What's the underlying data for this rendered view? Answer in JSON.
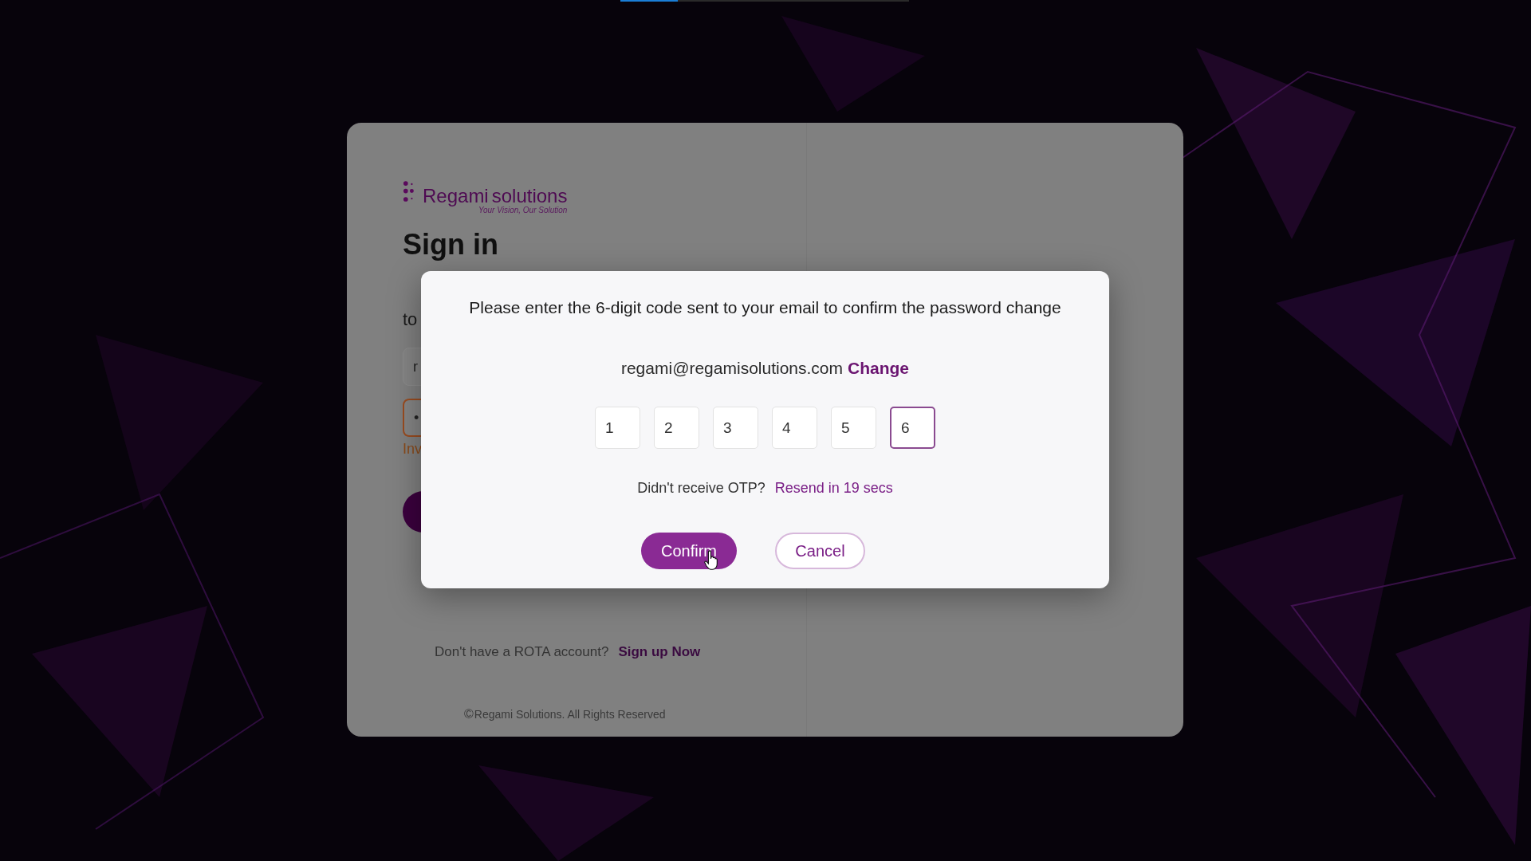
{
  "progress": {
    "level": 0.2
  },
  "brand": {
    "name_1": "Regami",
    "name_2": "solutions",
    "tagline": "Your Vision, Our Solution"
  },
  "signin": {
    "title": "Sign in",
    "subtitle": "to",
    "email_value": "r",
    "password_value": "•",
    "invalid": true,
    "error": "Inv"
  },
  "signup": {
    "prompt": "Don't have a ROTA account?",
    "link": "Sign up Now"
  },
  "copyright": {
    "symbol": "©",
    "text": "Regami Solutions. All Rights Reserved"
  },
  "dialog": {
    "message": "Please enter the 6-digit code sent to your email to confirm the password change",
    "email": "regami@regamisolutions.com",
    "change": "Change",
    "otp": [
      {
        "digit": "1",
        "focused": false
      },
      {
        "digit": "2",
        "focused": false
      },
      {
        "digit": "3",
        "focused": false
      },
      {
        "digit": "4",
        "focused": false
      },
      {
        "digit": "5",
        "focused": false
      },
      {
        "digit": "6",
        "focused": true
      }
    ],
    "resend_prompt": "Didn't receive OTP?",
    "resend": "Resend in 19 secs",
    "buttons": [
      {
        "label": "Confirm",
        "kind": "primary"
      },
      {
        "label": "Cancel",
        "kind": "secondary"
      }
    ]
  }
}
